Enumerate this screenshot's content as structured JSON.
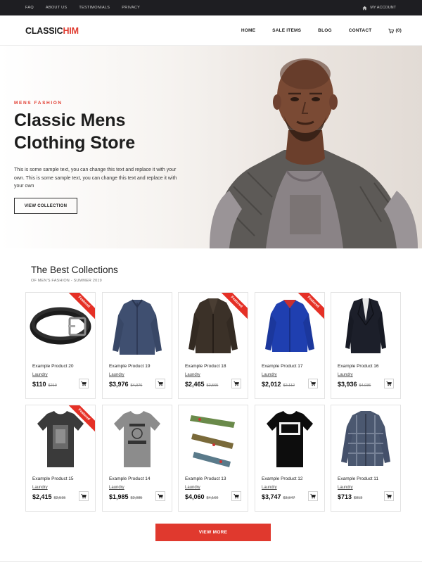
{
  "topbar": {
    "links": [
      "FAQ",
      "ABOUT US",
      "TESTIMONIALS",
      "PRIVACY"
    ],
    "account": "MY ACCOUNT"
  },
  "header": {
    "logo_part1": "CLASSIC",
    "logo_part2": "HIM",
    "nav": [
      "HOME",
      "SALE ITEMS",
      "BLOG",
      "CONTACT"
    ],
    "cart_count": "(0)"
  },
  "hero": {
    "eyebrow": "MENS FASHION",
    "title_line1": "Classic Mens",
    "title_line2": "Clothing Store",
    "description": "This is some sample text, you can change this text and replace it with your own. This is some sample text, you can change this text and replace it with your own",
    "cta": "VIEW COLLECTION"
  },
  "collections": {
    "title": "The Best Collections",
    "subtitle": "OF MEN'S FASHION - SUMMER 2019",
    "ribbon_text": "Featured",
    "products": [
      {
        "name": "Example Product 20",
        "category": "Laundry",
        "price": "$110",
        "old_price": "$210",
        "featured": true,
        "image": "belt"
      },
      {
        "name": "Example Product 19",
        "category": "Laundry",
        "price": "$3,976",
        "old_price": "$4,076",
        "featured": false,
        "image": "denim-shirt"
      },
      {
        "name": "Example Product 18",
        "category": "Laundry",
        "price": "$2,465",
        "old_price": "$2,565",
        "featured": true,
        "image": "leather-jacket"
      },
      {
        "name": "Example Product 17",
        "category": "Laundry",
        "price": "$2,012",
        "old_price": "$2,112",
        "featured": true,
        "image": "blue-jacket"
      },
      {
        "name": "Example Product 16",
        "category": "Laundry",
        "price": "$3,936",
        "old_price": "$4,036",
        "featured": false,
        "image": "blazer"
      },
      {
        "name": "Example Product 15",
        "category": "Laundry",
        "price": "$2,415",
        "old_price": "$2,515",
        "featured": true,
        "image": "band-tshirt"
      },
      {
        "name": "Example Product 14",
        "category": "Laundry",
        "price": "$1,985",
        "old_price": "$2,085",
        "featured": false,
        "image": "gym-tshirt"
      },
      {
        "name": "Example Product 13",
        "category": "Laundry",
        "price": "$4,060",
        "old_price": "$4,160",
        "featured": false,
        "image": "printed-belt"
      },
      {
        "name": "Example Product 12",
        "category": "Laundry",
        "price": "$3,747",
        "old_price": "$3,847",
        "featured": false,
        "image": "nwo-tshirt"
      },
      {
        "name": "Example Product 11",
        "category": "Laundry",
        "price": "$713",
        "old_price": "$813",
        "featured": false,
        "image": "plaid-shirt"
      }
    ],
    "view_more": "VIEW MORE"
  },
  "colors": {
    "accent": "#e03a2e",
    "topbar": "#1e1e22"
  }
}
